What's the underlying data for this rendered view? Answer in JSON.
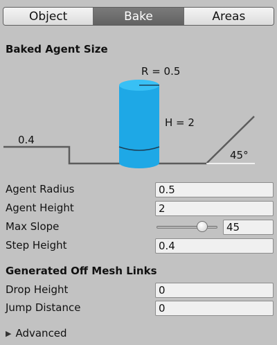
{
  "tabs": [
    {
      "label": "Object",
      "active": false
    },
    {
      "label": "Bake",
      "active": true
    },
    {
      "label": "Areas",
      "active": false
    }
  ],
  "baked_agent_size": {
    "title": "Baked Agent Size",
    "diagram": {
      "radius_label": "R = 0.5",
      "height_label": "H = 2",
      "step_label": "0.4",
      "slope_label": "45°",
      "cylinder_color": "#1ea8e6"
    },
    "fields": {
      "agent_radius": {
        "label": "Agent Radius",
        "value": "0.5"
      },
      "agent_height": {
        "label": "Agent Height",
        "value": "2"
      },
      "max_slope": {
        "label": "Max Slope",
        "value": "45",
        "slider_fraction": 0.75
      },
      "step_height": {
        "label": "Step Height",
        "value": "0.4"
      }
    }
  },
  "generated_off_mesh_links": {
    "title": "Generated Off Mesh Links",
    "fields": {
      "drop_height": {
        "label": "Drop Height",
        "value": "0"
      },
      "jump_distance": {
        "label": "Jump Distance",
        "value": "0"
      }
    }
  },
  "advanced": {
    "label": "Advanced",
    "expanded": false,
    "icon": "triangle-right-icon"
  }
}
